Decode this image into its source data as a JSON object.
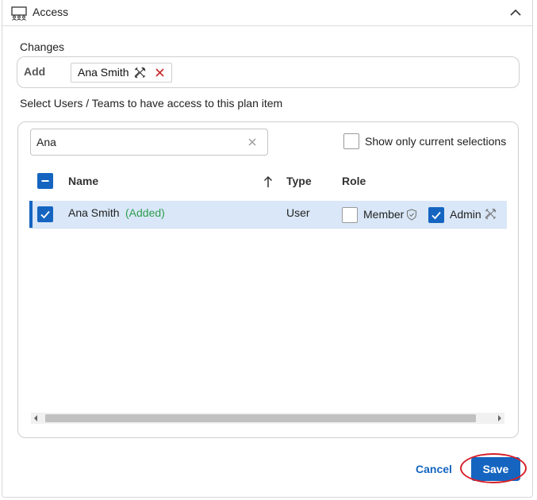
{
  "header": {
    "title": "Access",
    "icon": "team-board-icon",
    "collapse_icon": "chevron-up-icon"
  },
  "changes": {
    "label": "Changes",
    "add_label": "Add",
    "chips": [
      {
        "label": "Ana Smith",
        "icon": "tools-icon",
        "remove_icon": "close-icon"
      }
    ]
  },
  "select_label": "Select Users / Teams to have access to this plan item",
  "search": {
    "value": "Ana",
    "placeholder": ""
  },
  "show_only": {
    "label": "Show only current selections",
    "checked": false
  },
  "table": {
    "columns": {
      "name": "Name",
      "type": "Type",
      "role": "Role"
    },
    "sort": {
      "column": "Name",
      "direction": "ascending",
      "icon": "arrow-up-icon"
    },
    "header_checkbox": "indeterminate",
    "rows": [
      {
        "name": "Ana Smith",
        "status": "(Added)",
        "type": "User",
        "selected": true,
        "roles": [
          {
            "label": "Member",
            "checked": false,
            "icon": "shield-icon"
          },
          {
            "label": "Admin",
            "checked": true,
            "icon": "tools-icon"
          }
        ]
      }
    ]
  },
  "actions": {
    "cancel": "Cancel",
    "save": "Save"
  },
  "colors": {
    "accent": "#1565c0",
    "added": "#2e9e4f",
    "selected_row": "#d9e7f8",
    "highlight": "#d62028"
  }
}
